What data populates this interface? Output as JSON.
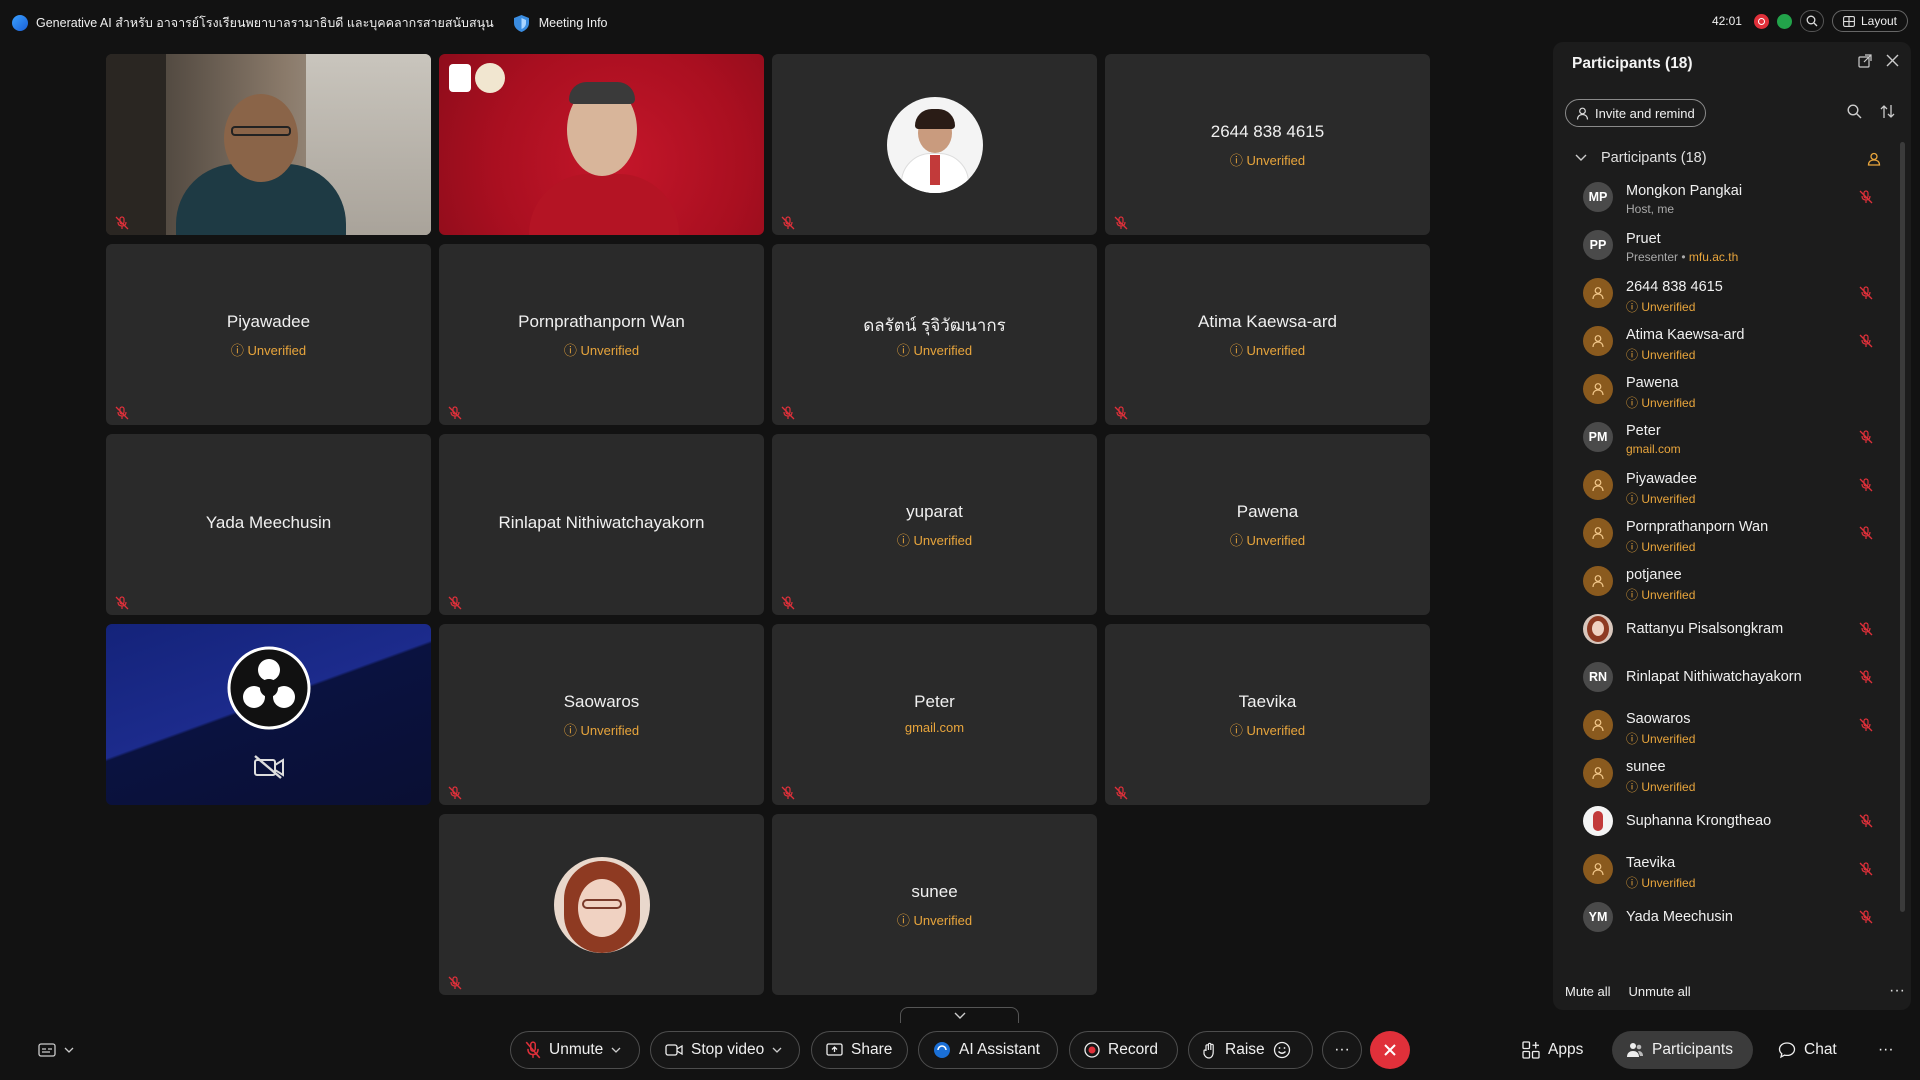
{
  "topbar": {
    "title": "Generative AI สำหรับ อาจารย์โรงเรียนพยาบาลรามาธิบดี และบุคคลากรสายสนับสนุน",
    "meeting_info": "Meeting Info",
    "clock": "42:01",
    "layout_label": "Layout"
  },
  "tiles": [
    {
      "name": "",
      "sub": ""
    },
    {
      "name": "",
      "sub": ""
    },
    {
      "name": "",
      "sub": ""
    },
    {
      "name": "2644 838 4615",
      "sub": "Unverified"
    },
    {
      "name": "Piyawadee",
      "sub": "Unverified"
    },
    {
      "name": "Pornprathanporn Wan",
      "sub": "Unverified"
    },
    {
      "name": "ดลรัตน์ รุจิวัฒนากร",
      "sub": "Unverified"
    },
    {
      "name": "Atima Kaewsa-ard",
      "sub": "Unverified"
    },
    {
      "name": "Yada Meechusin",
      "sub": ""
    },
    {
      "name": "Rinlapat Nithiwatchayakorn",
      "sub": ""
    },
    {
      "name": "yuparat",
      "sub": "Unverified"
    },
    {
      "name": "Pawena",
      "sub": "Unverified"
    },
    {
      "name": "",
      "sub": ""
    },
    {
      "name": "Saowaros",
      "sub": "Unverified"
    },
    {
      "name": "Peter",
      "sub": "gmail.com"
    },
    {
      "name": "Taevika",
      "sub": "Unverified"
    },
    {
      "name": "",
      "sub": ""
    },
    {
      "name": "sunee",
      "sub": "Unverified"
    }
  ],
  "panel": {
    "title": "Participants (18)",
    "invite_label": "Invite and remind",
    "group_label": "Participants (18)",
    "mute_all": "Mute all",
    "unmute_all": "Unmute all",
    "more": "···"
  },
  "participants": [
    {
      "avatar": "MP",
      "name": "Mongkon Pangkai",
      "sub": "Host, me"
    },
    {
      "avatar": "PP",
      "name": "Pruet",
      "sub_prefix": "Presenter • ",
      "sub": "mfu.ac.th"
    },
    {
      "avatar": "",
      "name": "2644 838 4615",
      "sub": "Unverified"
    },
    {
      "avatar": "",
      "name": "Atima Kaewsa-ard",
      "sub": "Unverified"
    },
    {
      "avatar": "",
      "name": "Pawena",
      "sub": "Unverified"
    },
    {
      "avatar": "PM",
      "name": "Peter",
      "sub": "gmail.com"
    },
    {
      "avatar": "",
      "name": "Piyawadee",
      "sub": "Unverified"
    },
    {
      "avatar": "",
      "name": "Pornprathanporn Wan",
      "sub": "Unverified"
    },
    {
      "avatar": "",
      "name": "potjanee",
      "sub": "Unverified"
    },
    {
      "avatar": "",
      "name": "Rattanyu Pisalsongkram",
      "sub": ""
    },
    {
      "avatar": "RN",
      "name": "Rinlapat Nithiwatchayakorn",
      "sub": ""
    },
    {
      "avatar": "",
      "name": "Saowaros",
      "sub": "Unverified"
    },
    {
      "avatar": "",
      "name": "sunee",
      "sub": "Unverified"
    },
    {
      "avatar": "",
      "name": "Suphanna Krongtheao",
      "sub": ""
    },
    {
      "avatar": "",
      "name": "Taevika",
      "sub": "Unverified"
    },
    {
      "avatar": "YM",
      "name": "Yada Meechusin",
      "sub": ""
    }
  ],
  "toolbar": {
    "unmute": "Unmute",
    "stop_video": "Stop video",
    "share": "Share",
    "ai_assistant": "AI Assistant",
    "record": "Record",
    "raise": "Raise",
    "more": "···",
    "apps": "Apps",
    "participants": "Participants",
    "chat": "Chat",
    "overflow": "···"
  },
  "colors": {
    "warning": "#e8a53c",
    "leave": "#e0303a",
    "recording": "#e0303a",
    "connection": "#22a34a"
  }
}
